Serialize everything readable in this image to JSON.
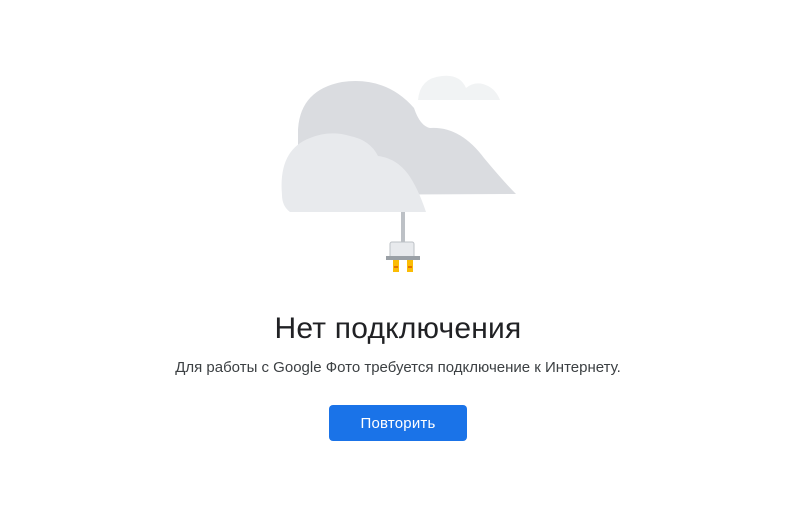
{
  "main": {
    "title": "Нет подключения",
    "subtitle": "Для работы с Google Фото требуется подключение к Интернету.",
    "retry_label": "Повторить"
  },
  "colors": {
    "accent": "#1a73e8",
    "cloud_dark": "#dadce0",
    "cloud_light": "#e8eaed",
    "cloud_small": "#f1f3f4",
    "plug_prongs": "#fbbc04",
    "title_text": "#202124",
    "body_text": "#3c4043"
  },
  "icons": {
    "illustration": "cloud-unplugged-icon"
  }
}
